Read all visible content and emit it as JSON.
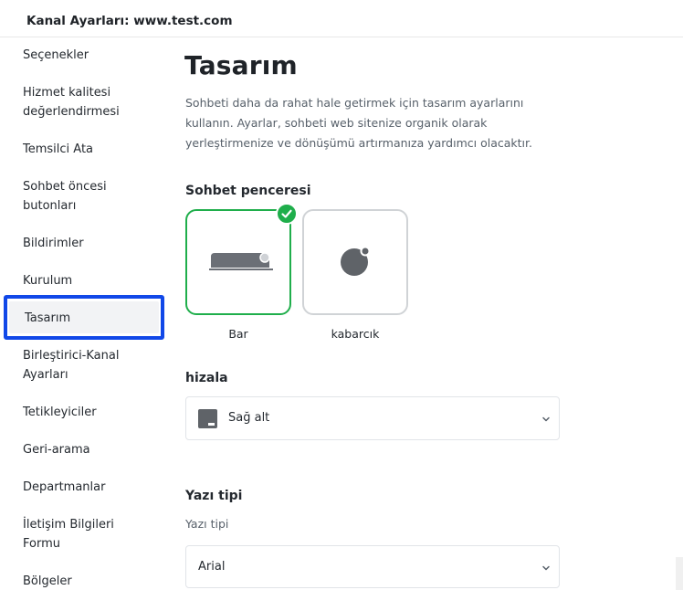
{
  "header": {
    "title": "Kanal Ayarları: www.test.com"
  },
  "sidebar": {
    "items": [
      {
        "label": "Seçenekler"
      },
      {
        "label": "Hizmet kalitesi değerlendirmesi"
      },
      {
        "label": "Temsilci Ata"
      },
      {
        "label": "Sohbet öncesi butonları"
      },
      {
        "label": "Bildirimler"
      },
      {
        "label": "Kurulum"
      },
      {
        "label": "Tasarım"
      },
      {
        "label": "Birleştirici-Kanal Ayarları"
      },
      {
        "label": "Tetikleyiciler"
      },
      {
        "label": "Geri-arama"
      },
      {
        "label": "Departmanlar"
      },
      {
        "label": "İletişim Bilgileri Formu"
      },
      {
        "label": "Bölgeler"
      }
    ],
    "active_item": "Tasarım"
  },
  "main": {
    "title": "Tasarım",
    "description": "Sohbeti daha da rahat hale getirmek için tasarım ayarlarını kullanın. Ayarlar, sohbeti web sitenize organik olarak yerleştirmenize ve dönüşümü artırmanıza yardımcı olacaktır.",
    "chat_window": {
      "title": "Sohbet penceresi",
      "options": [
        {
          "label": "Bar",
          "selected": true,
          "icon": "bar-widget-icon"
        },
        {
          "label": "kabarcık",
          "selected": false,
          "icon": "bubble-widget-icon"
        }
      ]
    },
    "align": {
      "title": "hizala",
      "value": "Sağ alt",
      "icon": "bottom-right-align-icon"
    },
    "font": {
      "title": "Yazı tipi",
      "sublabel": "Yazı tipi",
      "value": "Arial"
    }
  },
  "colors": {
    "selected_border": "#1fae4b",
    "active_highlight": "#1148e8",
    "icon_gray": "#5f6368"
  }
}
